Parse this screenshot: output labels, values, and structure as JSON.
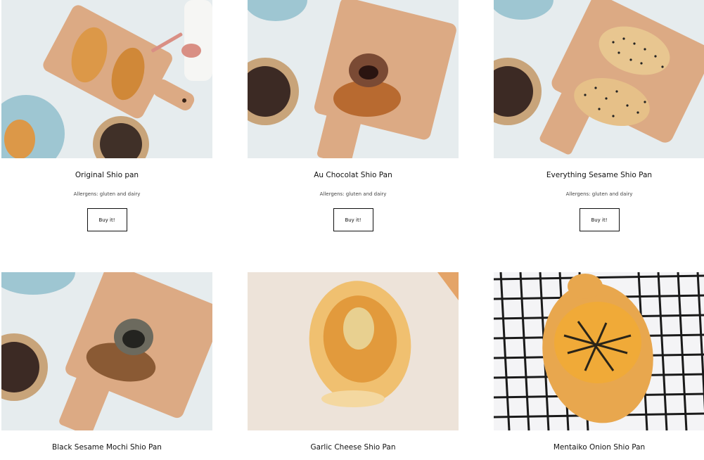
{
  "products": [
    {
      "name": "Original Shio pan",
      "allergens": "Allergens: gluten and dairy",
      "button_label": "Buy it!"
    },
    {
      "name": "Au Chocolat Shio Pan",
      "allergens": "Allergens: gluten and dairy",
      "button_label": "Buy it!"
    },
    {
      "name": "Everything Sesame Shio Pan",
      "allergens": "Allergens: gluten and dairy",
      "button_label": "Buy it!"
    },
    {
      "name": "Black Sesame Mochi Shio Pan"
    },
    {
      "name": "Garlic Cheese Shio Pan"
    },
    {
      "name": "Mentaiko Onion Shio Pan"
    }
  ],
  "colors": {
    "marble": "#e8eef0",
    "board": "#dba883",
    "plate": "#9ec6d2",
    "bread": "#d98f3e",
    "parchment": "#ede7df",
    "rack": "#1a1a1a"
  }
}
